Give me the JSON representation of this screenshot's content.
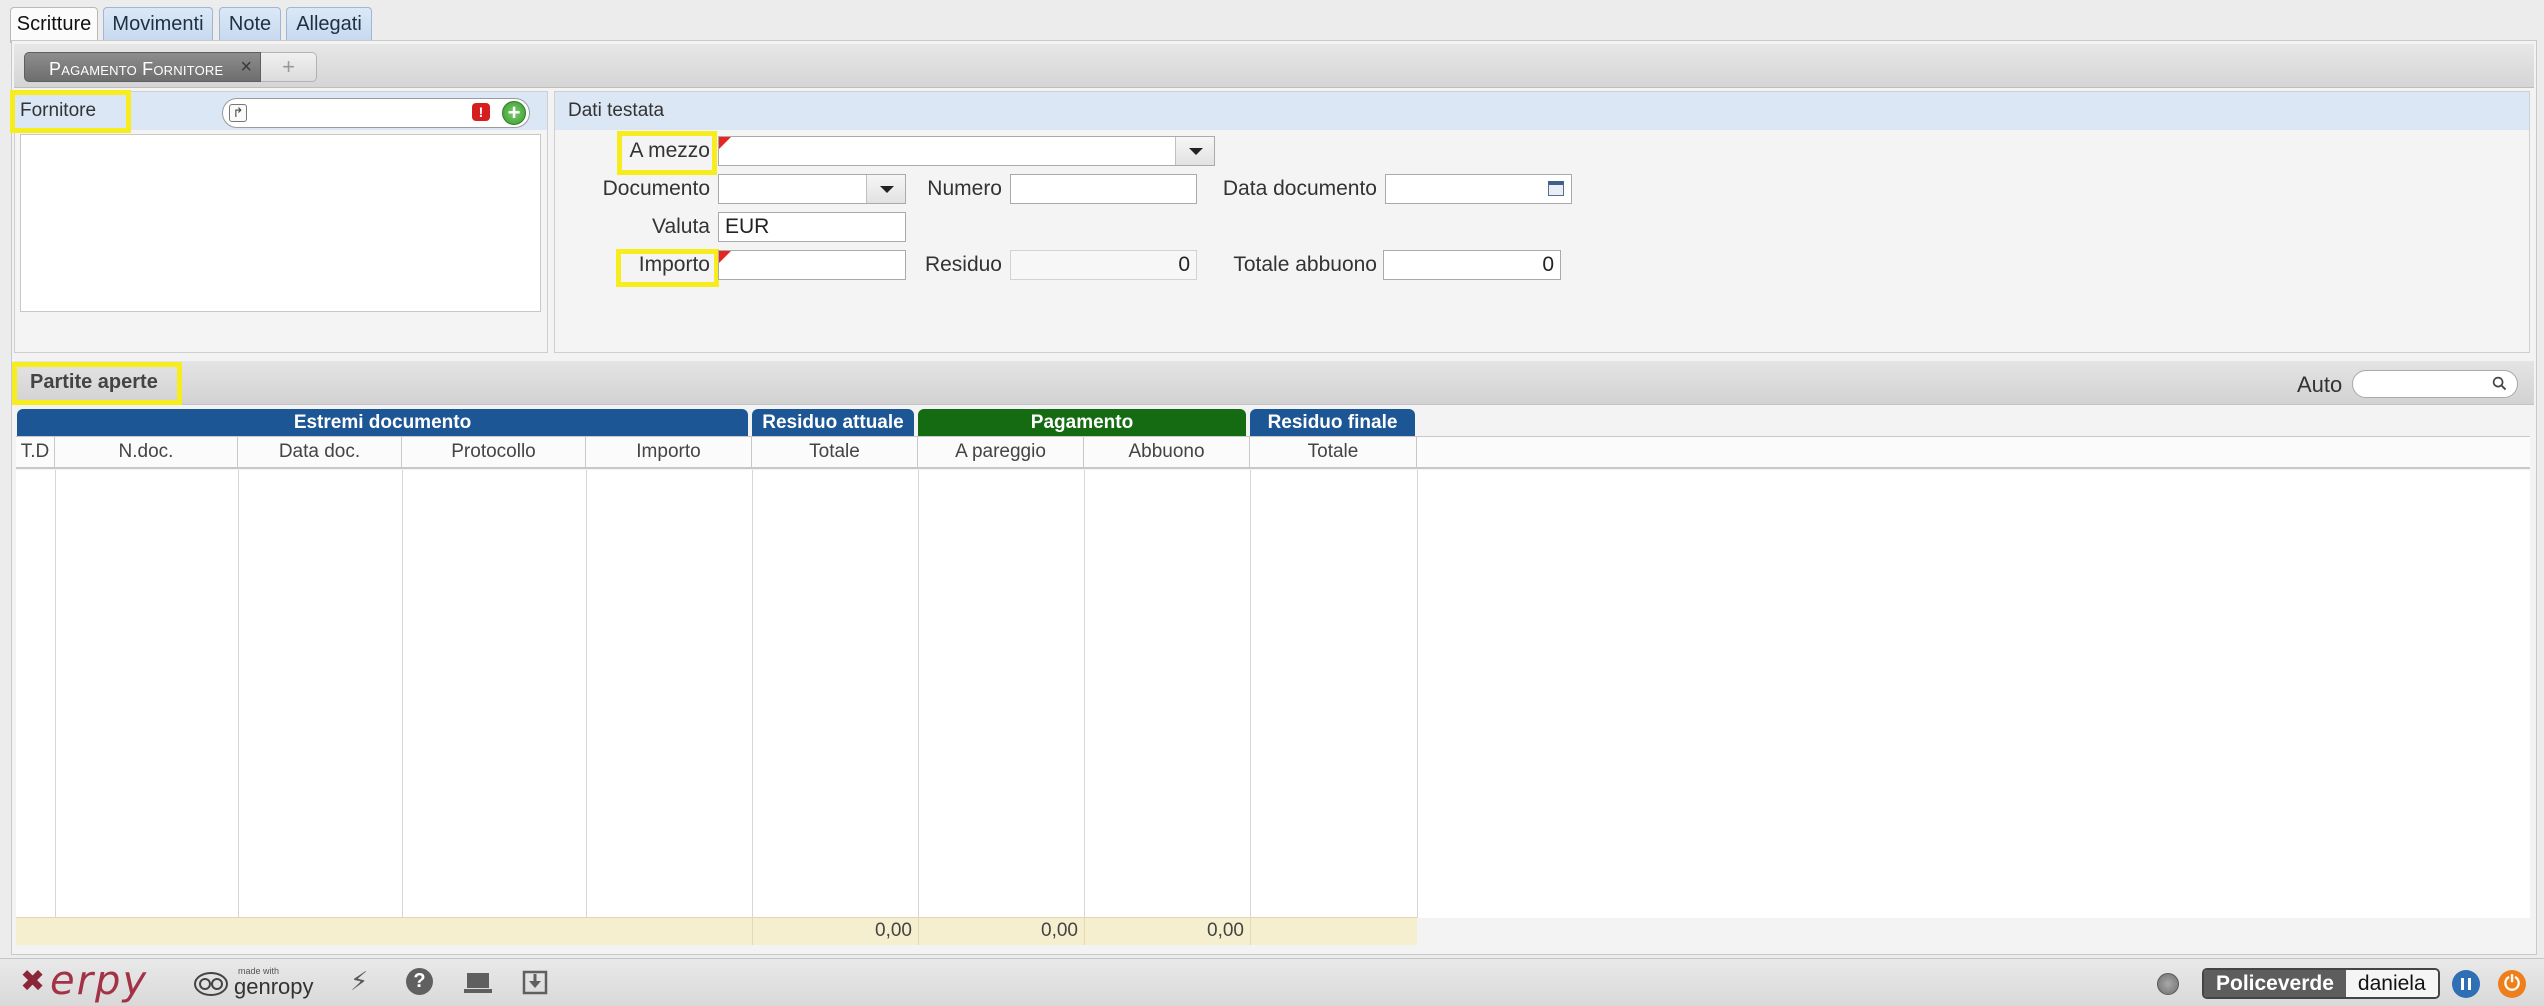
{
  "tabs": [
    "Scritture",
    "Movimenti",
    "Note",
    "Allegati"
  ],
  "subtab": {
    "label": "Pagamento Fornitore",
    "close": "×",
    "add": "+"
  },
  "fornitore": {
    "label": "Fornitore",
    "value": ""
  },
  "dati_testata": {
    "title": "Dati testata",
    "a_mezzo": {
      "label": "A mezzo",
      "value": ""
    },
    "documento": {
      "label": "Documento",
      "value": ""
    },
    "numero": {
      "label": "Numero",
      "value": ""
    },
    "data_documento": {
      "label": "Data documento",
      "value": ""
    },
    "valuta": {
      "label": "Valuta",
      "value": "EUR"
    },
    "importo": {
      "label": "Importo",
      "value": ""
    },
    "residuo": {
      "label": "Residuo",
      "value": "0"
    },
    "totale_abbuono": {
      "label": "Totale abbuono",
      "value": "0"
    }
  },
  "partite": {
    "title": "Partite aperte",
    "auto_label": "Auto",
    "search_value": ""
  },
  "grid": {
    "groups": [
      {
        "label": "Estremi documento",
        "color": "#1d5694"
      },
      {
        "label": "Residuo attuale",
        "color": "#1d5694"
      },
      {
        "label": "Pagamento",
        "color": "#146b12"
      },
      {
        "label": "Residuo finale",
        "color": "#1d5694"
      }
    ],
    "columns": [
      "T.D",
      "N.doc.",
      "Data doc.",
      "Protocollo",
      "Importo",
      "Totale",
      "A pareggio",
      "Abbuono",
      "Totale"
    ],
    "totals": [
      "0,00",
      "0,00",
      "0,00"
    ]
  },
  "statusbar": {
    "logo": "erpy",
    "made_with": "made with",
    "framework": "genropy",
    "company": "Policeverde",
    "user": "daniela"
  },
  "icons": [
    "bolt-icon",
    "help-icon",
    "laptop-icon",
    "download-icon",
    "status-dot-icon",
    "pause-icon",
    "power-icon"
  ]
}
